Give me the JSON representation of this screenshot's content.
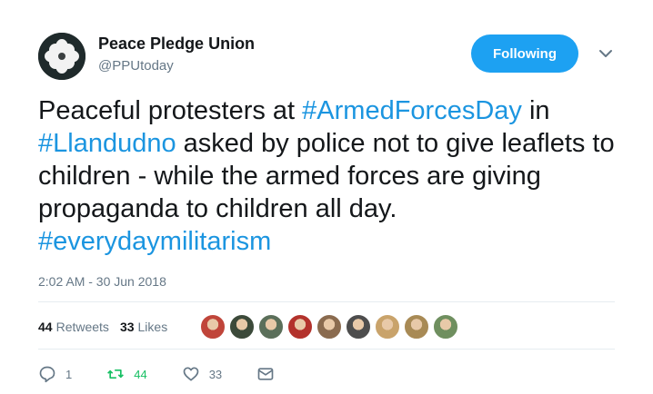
{
  "author": {
    "name": "Peace Pledge Union",
    "handle": "@PPUtoday",
    "follow_label": "Following"
  },
  "tweet": {
    "segments": [
      {
        "text": "Peaceful protesters at ",
        "tag": false
      },
      {
        "text": "#ArmedForcesDay",
        "tag": true
      },
      {
        "text": " in ",
        "tag": false
      },
      {
        "text": "#Llandudno",
        "tag": true
      },
      {
        "text": " asked by police not to give leaflets to children - while the armed forces are giving propaganda to children all day. ",
        "tag": false
      },
      {
        "text": "#everydaymilitarism",
        "tag": true
      }
    ],
    "timestamp": "2:02 AM - 30 Jun 2018"
  },
  "stats": {
    "retweets_count": "44",
    "retweets_label": "Retweets",
    "likes_count": "33",
    "likes_label": "Likes"
  },
  "liker_avatars": [
    "#c0453a",
    "#3c4a3a",
    "#5b6f5a",
    "#b3322c",
    "#8a6b4f",
    "#4d4d4d",
    "#c9a36b",
    "#a88a55",
    "#6f8f5f"
  ],
  "actions": {
    "reply_count": "1",
    "retweet_count": "44",
    "like_count": "33"
  },
  "colors": {
    "accent": "#1da1f2",
    "hashtag": "#1b95e0",
    "retweet_active": "#17bf63",
    "muted": "#657786"
  }
}
